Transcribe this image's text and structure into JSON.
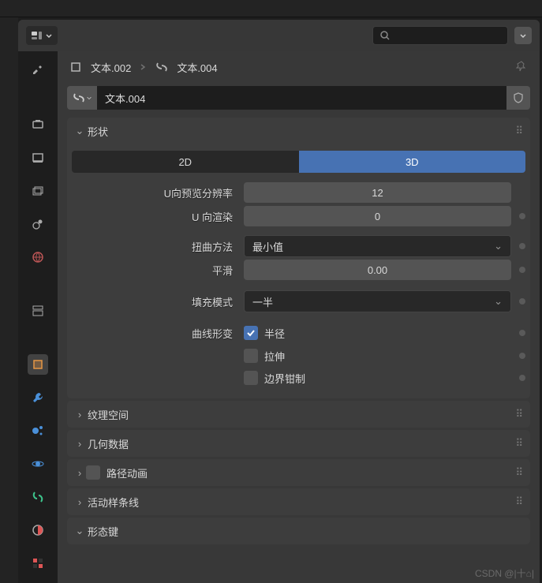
{
  "breadcrumb": {
    "item1": "文本.002",
    "item2": "文本.004"
  },
  "object_name": "文本.004",
  "shape": {
    "title": "形状",
    "mode_2d": "2D",
    "mode_3d": "3D",
    "preview_u_label": "U向预览分辨率",
    "preview_u_value": "12",
    "render_u_label": "U 向渲染",
    "render_u_value": "0",
    "twist_label": "扭曲方法",
    "twist_value": "最小值",
    "smooth_label": "平滑",
    "smooth_value": "0.00",
    "fill_label": "填充模式",
    "fill_value": "一半",
    "deform_label": "曲线形变",
    "radius": "半径",
    "stretch": "拉伸",
    "clamp": "边界钳制"
  },
  "sections": {
    "texture_space": "纹理空间",
    "geometry": "几何数据",
    "path_anim": "路径动画",
    "active_spline": "活动样条线",
    "shape_keys": "形态键"
  },
  "watermark": "CSDN @|十⌂|"
}
